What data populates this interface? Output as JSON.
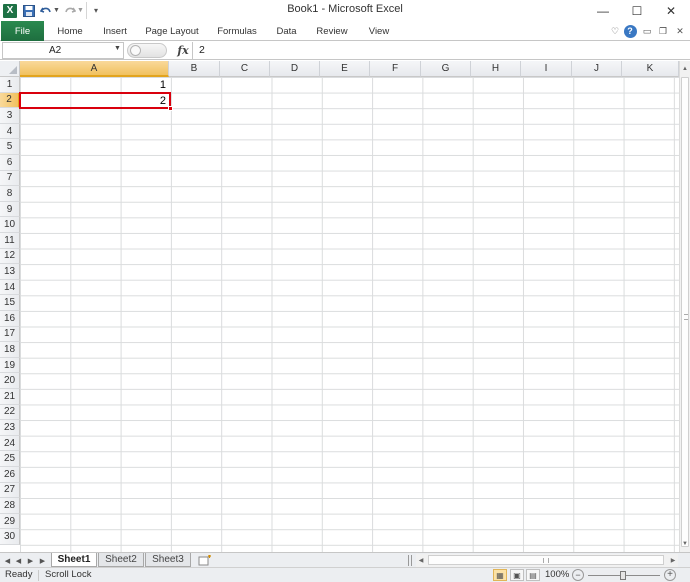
{
  "window": {
    "title": "Book1 - Microsoft Excel",
    "icons": [
      "excel-logo-icon",
      "save-icon",
      "undo-icon",
      "redo-icon",
      "minimize-icon",
      "maximize-icon",
      "close-icon"
    ]
  },
  "ribbon": {
    "tabs": [
      "File",
      "Home",
      "Insert",
      "Page Layout",
      "Formulas",
      "Data",
      "Review",
      "View"
    ],
    "file_color": "#217346"
  },
  "formula_bar": {
    "name_box": "A2",
    "fx_label": "fx",
    "formula": "2"
  },
  "grid": {
    "columns": [
      "A",
      "B",
      "C",
      "D",
      "E",
      "F",
      "G",
      "H",
      "I",
      "J",
      "K"
    ],
    "rows": [
      "1",
      "2",
      "3",
      "4",
      "5",
      "6",
      "7",
      "8",
      "9",
      "10",
      "11",
      "12",
      "13",
      "14",
      "15",
      "16",
      "17",
      "18",
      "19",
      "20",
      "21",
      "22",
      "23",
      "24",
      "25",
      "26",
      "27",
      "28",
      "29",
      "30"
    ],
    "active_column": "A",
    "active_row": "2",
    "selected_cell": "A2",
    "selection_color": "#d9000d",
    "cells": {
      "A1": "1",
      "A2": "2"
    }
  },
  "sheets": {
    "tabs": [
      "Sheet1",
      "Sheet2",
      "Sheet3"
    ],
    "active": "Sheet1"
  },
  "status": {
    "ready": "Ready",
    "scroll_lock": "Scroll Lock",
    "zoom": "100%"
  }
}
